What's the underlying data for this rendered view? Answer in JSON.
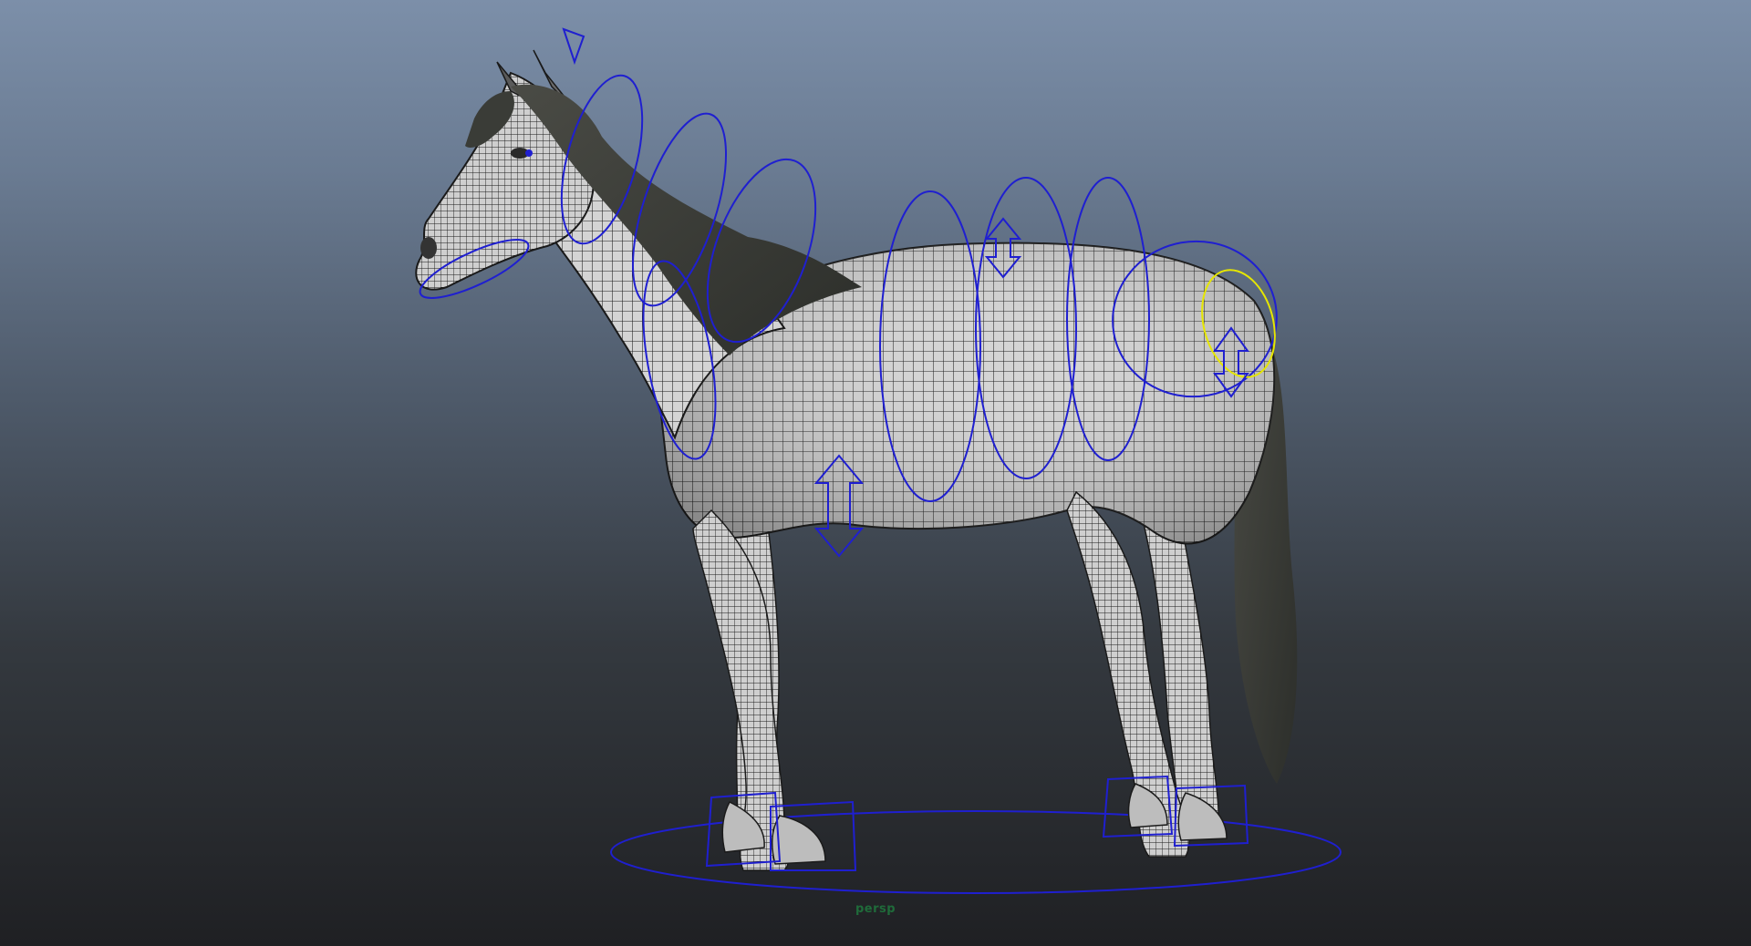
{
  "viewport": {
    "camera_label": "persp",
    "camera_label_color": "#1f6b3a",
    "background_top": "#7c8fa9",
    "background_bottom": "#1f2023"
  },
  "scene": {
    "subject": "horse-mesh",
    "mesh_color": "#d2d2d2",
    "wire_color": "#1a1a1a",
    "mane_color": "#3b3d38",
    "control_color": "#1f1fd0",
    "selected_control_color": "#e6e600"
  }
}
